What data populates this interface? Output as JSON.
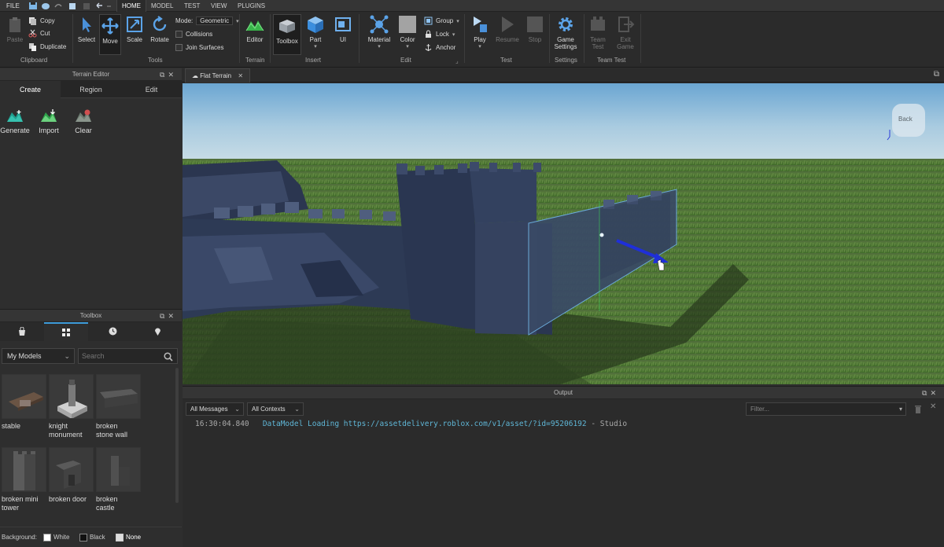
{
  "menu": {
    "file": "FILE",
    "tabs": [
      "HOME",
      "MODEL",
      "TEST",
      "VIEW",
      "PLUGINS"
    ],
    "active_tab": "HOME"
  },
  "ribbon": {
    "clipboard": {
      "paste": "Paste",
      "copy": "Copy",
      "cut": "Cut",
      "duplicate": "Duplicate",
      "label": "Clipboard"
    },
    "tools": {
      "select": "Select",
      "move": "Move",
      "scale": "Scale",
      "rotate": "Rotate",
      "label": "Tools"
    },
    "mode": {
      "label": "Mode:",
      "value": "Geometric",
      "collisions": "Collisions",
      "join_surfaces": "Join Surfaces"
    },
    "terrain": {
      "editor": "Editor",
      "label": "Terrain"
    },
    "insert": {
      "toolbox": "Toolbox",
      "part": "Part",
      "ui": "UI",
      "label": "Insert"
    },
    "edit": {
      "material": "Material",
      "color": "Color",
      "group": "Group",
      "lock": "Lock",
      "anchor": "Anchor",
      "label": "Edit"
    },
    "test": {
      "play": "Play",
      "resume": "Resume",
      "stop": "Stop",
      "label": "Test"
    },
    "settings": {
      "game_settings_1": "Game",
      "game_settings_2": "Settings",
      "label": "Settings"
    },
    "team_test": {
      "team_test_1": "Team",
      "team_test_2": "Test",
      "exit_game_1": "Exit",
      "exit_game_2": "Game",
      "label": "Team Test"
    }
  },
  "terrain_editor": {
    "title": "Terrain Editor",
    "tabs": [
      "Create",
      "Region",
      "Edit"
    ],
    "tools": [
      "Generate",
      "Import",
      "Clear"
    ]
  },
  "toolbox": {
    "title": "Toolbox",
    "category": "My Models",
    "search_placeholder": "Search",
    "assets": [
      {
        "name_1": "stable",
        "name_2": ""
      },
      {
        "name_1": "knight",
        "name_2": "monument"
      },
      {
        "name_1": "broken",
        "name_2": "stone wall"
      },
      {
        "name_1": "broken mini",
        "name_2": "tower"
      },
      {
        "name_1": "broken door",
        "name_2": ""
      },
      {
        "name_1": "broken",
        "name_2": "castle"
      }
    ],
    "background": {
      "label": "Background:",
      "white": "White",
      "black": "Black",
      "none": "None"
    }
  },
  "document": {
    "tab": "Flat Terrain",
    "viewcube_label": "Back"
  },
  "output": {
    "title": "Output",
    "messages_filter": "All Messages",
    "contexts_filter": "All Contexts",
    "filter_placeholder": "Filter...",
    "log": {
      "time": "16:30:04.840",
      "message": "DataModel Loading https://assetdelivery.roblox.com/v1/asset/?id=95206192",
      "source": "  -  Studio"
    }
  },
  "colors": {
    "accent": "#3d9bd9",
    "panel": "#2e2e2e",
    "ribbon": "#2b2b2b",
    "log_text": "#5fb6d6"
  }
}
